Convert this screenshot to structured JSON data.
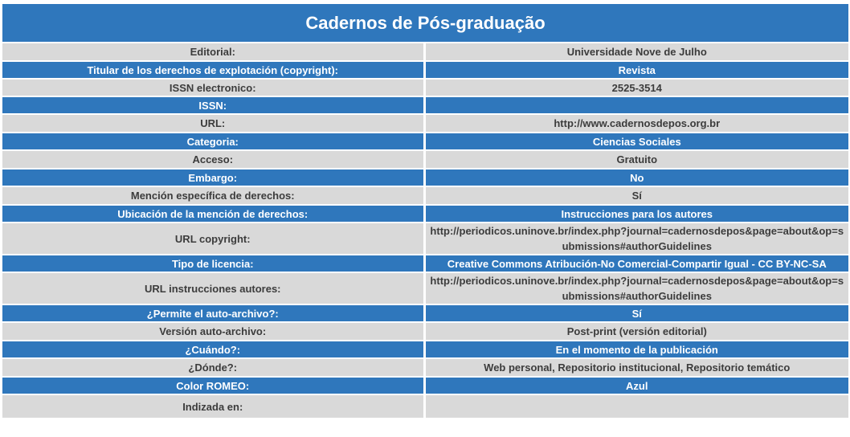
{
  "title": "Cadernos de Pós-graduação",
  "rows": [
    {
      "label": "Editorial:",
      "value": "Universidade Nove de Julho"
    },
    {
      "label": "Titular de los derechos de explotación (copyright):",
      "value": "Revista"
    },
    {
      "label": "ISSN electronico:",
      "value": "2525-3514"
    },
    {
      "label": "ISSN:",
      "value": ""
    },
    {
      "label": "URL:",
      "value": "http://www.cadernosdepos.org.br"
    },
    {
      "label": "Categoria:",
      "value": "Ciencias Sociales"
    },
    {
      "label": "Acceso:",
      "value": "Gratuito"
    },
    {
      "label": "Embargo:",
      "value": "No"
    },
    {
      "label": "Mención específica de derechos:",
      "value": "Sí"
    },
    {
      "label": "Ubicación de la mención de derechos:",
      "value": "Instrucciones para los autores"
    },
    {
      "label": "URL copyright:",
      "value": "http://periodicos.uninove.br/index.php?journal=cadernosdepos&page=about&op=submissions#authorGuidelines"
    },
    {
      "label": "Tipo de licencia:",
      "value": "Creative Commons Atribución-No Comercial-Compartir Igual - CC BY-NC-SA"
    },
    {
      "label": "URL instrucciones autores:",
      "value": "http://periodicos.uninove.br/index.php?journal=cadernosdepos&page=about&op=submissions#authorGuidelines"
    },
    {
      "label": "¿Permite el auto-archivo?:",
      "value": "Sí"
    },
    {
      "label": "Versión auto-archivo:",
      "value": "Post-print (versión editorial)"
    },
    {
      "label": "¿Cuándo?:",
      "value": "En el momento de la publicación"
    },
    {
      "label": "¿Dónde?:",
      "value": "Web personal, Repositorio institucional, Repositorio temático"
    },
    {
      "label": "Color ROMEO:",
      "value": "Azul"
    },
    {
      "label": "Indizada en:",
      "value": ""
    }
  ],
  "colors": {
    "header_blue": "#2f77bc",
    "row_grey": "#d9d9d9",
    "text_dark": "#3c3c3c",
    "text_light": "#ffffff"
  }
}
